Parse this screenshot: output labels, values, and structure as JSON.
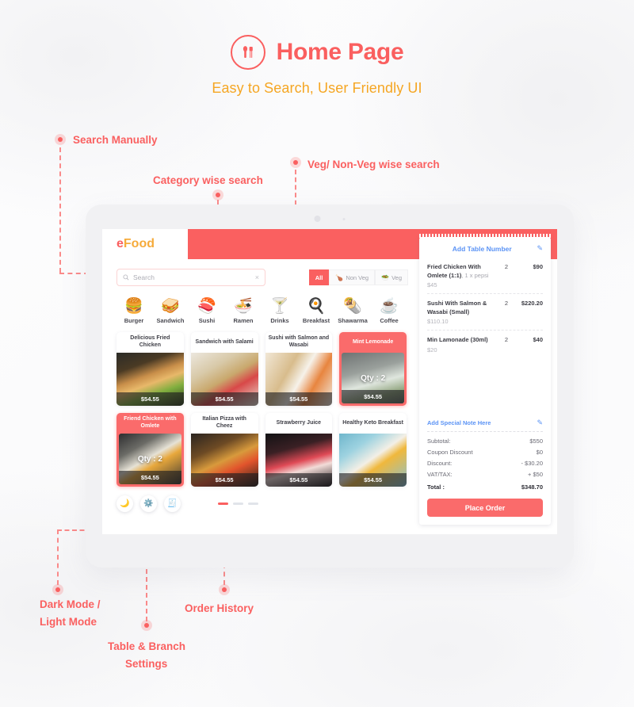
{
  "hero": {
    "title": "Home Page",
    "subtitle": "Easy to Search, User Friendly UI",
    "badge_icon": "spoon-fork-icon",
    "accent": "#fa5f5f",
    "subtitle_color": "#f5a623"
  },
  "annotations": [
    {
      "label": "Search Manually"
    },
    {
      "label": "Category wise search"
    },
    {
      "label": "Veg/ Non-Veg wise search"
    },
    {
      "label": "Dark Mode /"
    },
    {
      "label": "Light Mode"
    },
    {
      "label": "Table & Branch"
    },
    {
      "label": "Settings"
    },
    {
      "label": "Order History"
    }
  ],
  "app": {
    "brand": {
      "prefix": "e",
      "suffix": "Food"
    },
    "search": {
      "placeholder": "Search",
      "value": "",
      "clear_label": "×",
      "icon": "search-icon"
    },
    "filters": [
      {
        "label": "All",
        "icon": "",
        "active": true
      },
      {
        "label": "Non Veg",
        "icon": "🍗",
        "active": false
      },
      {
        "label": "Veg",
        "icon": "🥗",
        "active": false
      }
    ],
    "categories": [
      {
        "name": "Burger",
        "emoji": "🍔"
      },
      {
        "name": "Sandwich",
        "emoji": "🥪"
      },
      {
        "name": "Sushi",
        "emoji": "🍣"
      },
      {
        "name": "Ramen",
        "emoji": "🍜"
      },
      {
        "name": "Drinks",
        "emoji": "🍸"
      },
      {
        "name": "Breakfast",
        "emoji": "🍳"
      },
      {
        "name": "Shawarma",
        "emoji": "🌯"
      },
      {
        "name": "Coffee",
        "emoji": "☕"
      }
    ],
    "products": [
      {
        "name": "Delicious Fried Chicken",
        "price": "$54.55",
        "qty": "",
        "selected": false,
        "photo": "ph-burger"
      },
      {
        "name": "Sandwich with Salami",
        "price": "$54.55",
        "qty": "",
        "selected": false,
        "photo": "ph-sandwich"
      },
      {
        "name": "Sushi with Salmon and Wasabi",
        "price": "$54.55",
        "qty": "",
        "selected": false,
        "photo": "ph-sushi"
      },
      {
        "name": "Mint Lemonade",
        "price": "$54.55",
        "qty": "Qty : 2",
        "selected": true,
        "photo": "ph-mint"
      },
      {
        "name": "Friend Chicken with Omlete",
        "price": "$54.55",
        "qty": "Qty : 2",
        "selected": true,
        "photo": "ph-omlete"
      },
      {
        "name": "Italian Pizza with Cheez",
        "price": "$54.55",
        "qty": "",
        "selected": false,
        "photo": "ph-pizza"
      },
      {
        "name": "Strawberry Juice",
        "price": "$54.55",
        "qty": "",
        "selected": false,
        "photo": "ph-juice"
      },
      {
        "name": "Healthy Keto Breakfast",
        "price": "$54.55",
        "qty": "",
        "selected": false,
        "photo": "ph-keto"
      }
    ],
    "toolbar": [
      {
        "icon": "🌙",
        "name": "dark-mode-toggle"
      },
      {
        "icon": "⚙️",
        "name": "settings-button"
      },
      {
        "icon": "🧾",
        "name": "order-history-button"
      }
    ],
    "pagination": {
      "total": 3,
      "active": 1
    },
    "order": {
      "table_link": "Add Table Number",
      "edit_icon": "pencil-icon",
      "items": [
        {
          "name": "Fried Chicken With Omlete (1:1)",
          "addon": ", 1 x pepsi",
          "qty": "2",
          "amount": "$90",
          "unit_price": "$45"
        },
        {
          "name": "Sushi With Salmon & Wasabi  (Small)",
          "addon": "",
          "qty": "2",
          "amount": "$220.20",
          "unit_price": "$110.10"
        },
        {
          "name": "Min Lamonade (30ml)",
          "addon": "",
          "qty": "2",
          "amount": "$40",
          "unit_price": "$20"
        }
      ],
      "note_link": "Add Special Note Here",
      "totals": [
        {
          "label": "Subtotal:",
          "value": "$550"
        },
        {
          "label": "Coupon Discount",
          "value": "$0"
        },
        {
          "label": "Discount:",
          "value": "- $30.20"
        },
        {
          "label": "VAT/TAX:",
          "value": "+ $50"
        }
      ],
      "grand_total": {
        "label": "Total :",
        "value": "$348.70"
      },
      "place_order": "Place Order"
    }
  }
}
